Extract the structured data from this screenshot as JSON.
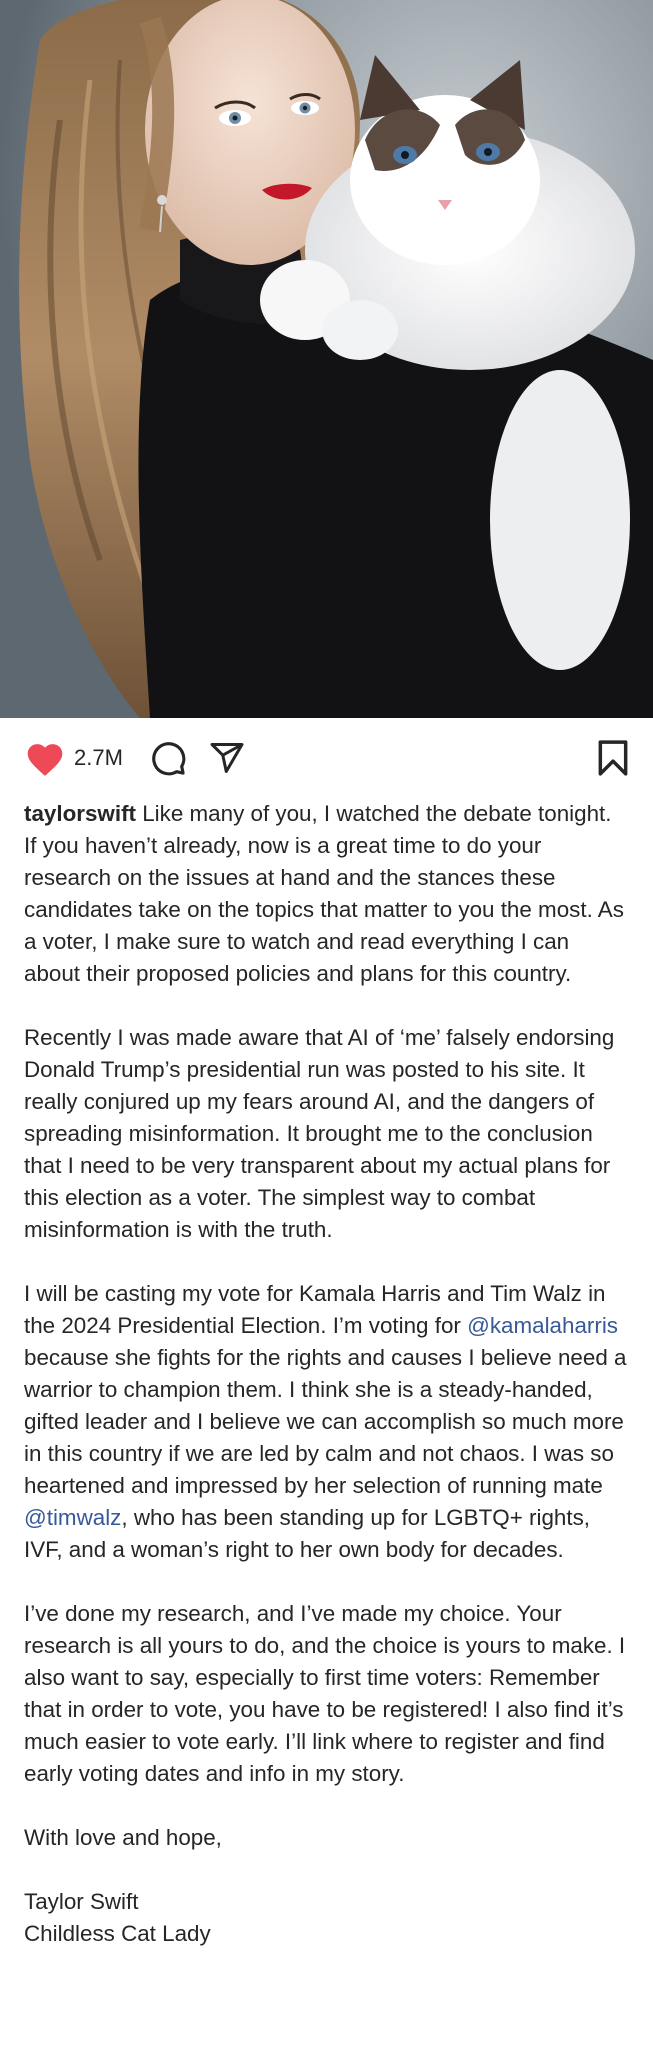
{
  "post": {
    "image_alt": "Portrait of a woman with long wavy hair and red lipstick wearing a black turtleneck, holding a fluffy ragdoll cat",
    "likes": "2.7M",
    "username": "taylorswift",
    "icons": {
      "like": "heart-icon-filled",
      "comment": "comment-bubble-icon",
      "share": "send-icon",
      "save": "bookmark-icon"
    },
    "colors": {
      "like_red": "#ed4956",
      "mention_blue": "#385898",
      "text": "#262626"
    },
    "caption": {
      "p1_text": "Like many of you, I watched the debate tonight. If you haven’t already, now is a great time to do your research on the issues at hand and the stances these candidates take on the topics that matter to you the most. As a voter, I make sure to watch and read everything I can about their proposed policies and plans for this country.",
      "p2_text": "Recently I was made aware that AI of ‘me’ falsely endorsing Donald Trump’s presidential run was posted to his site. It really conjured up my fears around AI, and the dangers of spreading misinformation. It brought me to the conclusion that I need to be very transparent about my actual plans for this election as a voter. The simplest way to combat misinformation is with the truth.",
      "p3_part1": "I will be casting my vote for Kamala Harris and Tim Walz in the 2024 Presidential Election. I’m voting for ",
      "p3_mention1": "@kamalaharris",
      "p3_part2": " because she fights for the rights and causes I believe need a warrior to champion them. I think she is a steady-handed, gifted leader and I believe we can accomplish so much more in this country if we are led by calm and not chaos. I was so heartened and impressed by her selection of running mate ",
      "p3_mention2": "@timwalz",
      "p3_part3": ", who has been standing up for LGBTQ+ rights, IVF, and a woman’s right to her own body for decades.",
      "p4_text": "I’ve done my research, and I’ve made my choice. Your research is all yours to do, and the choice is yours to make. I also want to say, especially to first time voters: Remember that in order to vote, you have to be registered! I also find it’s much easier to vote early. I’ll link where to register and find early voting dates and info in my story.",
      "p5_text": "With love and hope,",
      "signature_name": "Taylor Swift",
      "signature_title": "Childless Cat Lady"
    }
  }
}
